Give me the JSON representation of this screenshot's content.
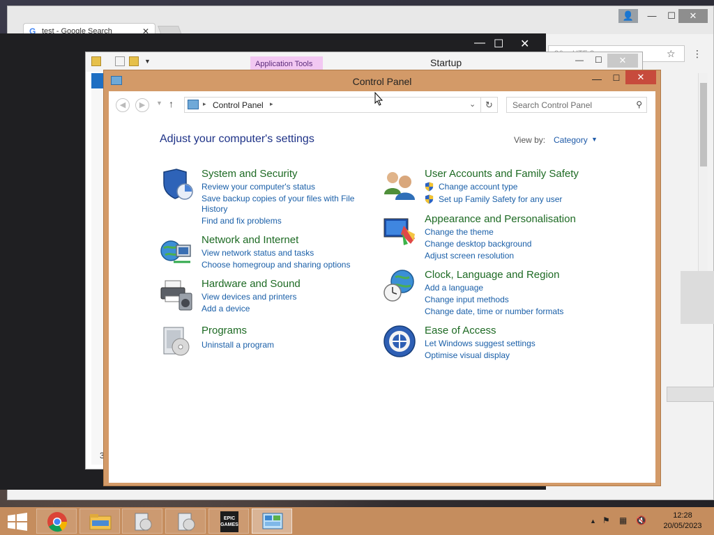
{
  "chrome": {
    "tab_title": "test - Google Search",
    "tab_close": "✕",
    "omnibox": "8&q=UTF-8",
    "controls": {
      "user": "👤",
      "min": "—",
      "max": "☐",
      "close": "✕"
    }
  },
  "darkwin": {
    "min": "—",
    "max": "☐",
    "close": "✕"
  },
  "startup": {
    "title": "Startup",
    "app_tools": "Application Tools",
    "controls": {
      "min": "—",
      "max": "☐",
      "close": "✕"
    },
    "left_digit": "3"
  },
  "control_panel": {
    "title": "Control Panel",
    "controls": {
      "min": "—",
      "max": "☐",
      "close": "✕"
    },
    "address": {
      "path": "Control Panel",
      "sep": "▸"
    },
    "search_placeholder": "Search Control Panel",
    "heading": "Adjust your computer's settings",
    "view_by_label": "View by:",
    "view_by_value": "Category",
    "categories_left": [
      {
        "title": "System and Security",
        "icon": "shield-icon",
        "links": [
          "Review your computer's status",
          "Save backup copies of your files with File",
          "History",
          "Find and fix problems"
        ]
      },
      {
        "title": "Network and Internet",
        "icon": "network-icon",
        "links": [
          "View network status and tasks",
          "Choose homegroup and sharing options"
        ]
      },
      {
        "title": "Hardware and Sound",
        "icon": "printer-icon",
        "links": [
          "View devices and printers",
          "Add a device"
        ]
      },
      {
        "title": "Programs",
        "icon": "programs-icon",
        "links": [
          "Uninstall a program"
        ]
      }
    ],
    "categories_right": [
      {
        "title": "User Accounts and Family Safety",
        "icon": "users-icon",
        "links": [
          "Change account type",
          "Set up Family Safety for any user"
        ]
      },
      {
        "title": "Appearance and Personalisation",
        "icon": "appearance-icon",
        "links": [
          "Change the theme",
          "Change desktop background",
          "Adjust screen resolution"
        ]
      },
      {
        "title": "Clock, Language and Region",
        "icon": "clock-globe-icon",
        "links": [
          "Add a language",
          "Change input methods",
          "Change date, time or number formats"
        ]
      },
      {
        "title": "Ease of Access",
        "icon": "ease-of-access-icon",
        "links": [
          "Let Windows suggest settings",
          "Optimise visual display"
        ]
      }
    ]
  },
  "taskbar": {
    "epic_label": "EPIC\nGAMES",
    "clock_time": "12:28",
    "clock_date": "20/05/2023",
    "tray_caret": "▲"
  }
}
